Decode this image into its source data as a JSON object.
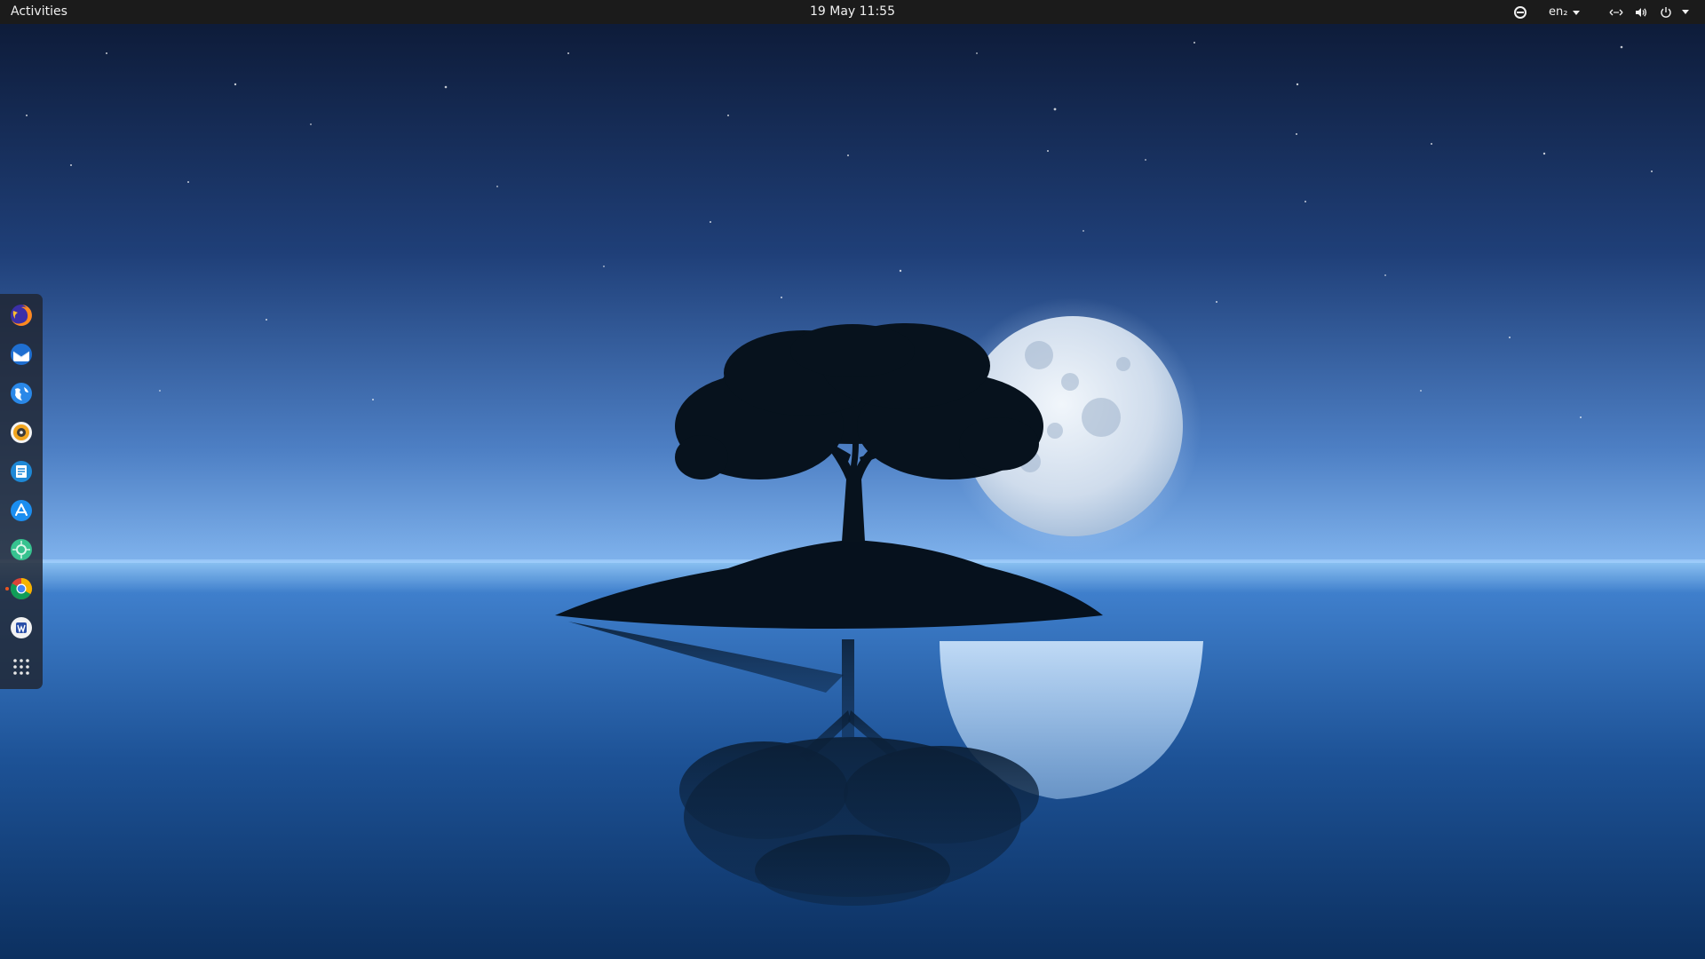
{
  "topbar": {
    "activities_label": "Activities",
    "clock": "19 May  11:55",
    "keyboard_layout": "en₂",
    "tray_icons": [
      "circle-status-icon",
      "network-icon",
      "volume-icon",
      "power-icon",
      "system-menu-arrow-icon"
    ]
  },
  "dock": {
    "apps": [
      {
        "name": "firefox",
        "icon": "firefox-icon",
        "running": false
      },
      {
        "name": "thunderbird",
        "icon": "thunderbird-icon",
        "running": false
      },
      {
        "name": "browser",
        "icon": "browser-globe-icon",
        "running": false
      },
      {
        "name": "rhythmbox",
        "icon": "rhythmbox-icon",
        "running": false
      },
      {
        "name": "libreoffice-writer",
        "icon": "writer-icon",
        "running": false
      },
      {
        "name": "app-store",
        "icon": "app-store-icon",
        "running": false
      },
      {
        "name": "software",
        "icon": "green-app-icon",
        "running": false
      },
      {
        "name": "chrome",
        "icon": "chrome-icon",
        "running": true
      },
      {
        "name": "wps",
        "icon": "wps-icon",
        "running": false
      },
      {
        "name": "show-applications",
        "icon": "app-grid-icon",
        "running": false
      }
    ]
  },
  "colors": {
    "topbar_bg": "#1b1b1b",
    "dock_bg": "#202430",
    "accent_running": "#e95420",
    "sky_top": "#0d1b36",
    "horizon": "#6aa8e8",
    "sea_bottom": "#0a2a55"
  }
}
